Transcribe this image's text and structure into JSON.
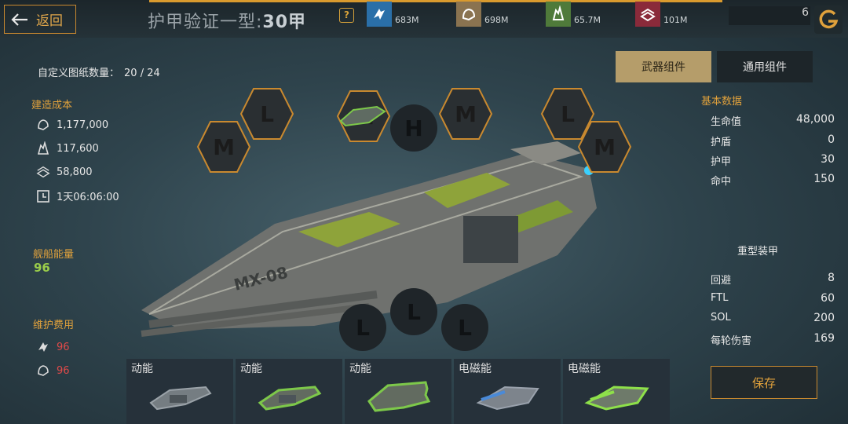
{
  "header": {
    "back_label": "返回",
    "title_text": "护甲验证一型:",
    "title_num": "30甲",
    "help_icon": "?",
    "resources": [
      {
        "icon": "metal-icon",
        "value": "683M",
        "color": "#2a6fa8"
      },
      {
        "icon": "crystal-icon",
        "value": "698M",
        "color": "#8a7350"
      },
      {
        "icon": "deuterium-icon",
        "value": "65.7M",
        "color": "#4f7a3a"
      },
      {
        "icon": "alloy-icon",
        "value": "101M",
        "color": "#8a2a3a"
      }
    ],
    "level": "6"
  },
  "left": {
    "blueprint_label": "自定义图纸数量：",
    "blueprint_count": "20 / 24",
    "build_cost_label": "建造成本",
    "costs": [
      {
        "icon": "ore-icon",
        "value": "1,177,000"
      },
      {
        "icon": "crystal-icon",
        "value": "117,600"
      },
      {
        "icon": "alloy-icon",
        "value": "58,800"
      },
      {
        "icon": "clock-icon",
        "value": "1天06:06:00"
      }
    ],
    "energy_label": "舰船能量",
    "energy_value": "96",
    "upkeep_label": "维护费用",
    "upkeep": [
      {
        "icon": "metal-icon",
        "value": "96"
      },
      {
        "icon": "ore-icon",
        "value": "96"
      }
    ]
  },
  "tabs": {
    "weapon": "武器组件",
    "general": "通用组件"
  },
  "slots": {
    "hex": [
      "L",
      "M",
      "M",
      "M",
      "L",
      "M"
    ],
    "center": "H",
    "bottom": [
      "L",
      "L",
      "L"
    ]
  },
  "ship_hull_text": "MX-08",
  "right": {
    "basic_label": "基本数据",
    "basic": [
      {
        "k": "生命值",
        "v": "48,000"
      },
      {
        "k": "护盾",
        "v": "0"
      },
      {
        "k": "护甲",
        "v": "30"
      },
      {
        "k": "命中",
        "v": "150"
      }
    ],
    "armor_type": "重型装甲",
    "extra": [
      {
        "k": "回避",
        "v": "8"
      },
      {
        "k": "FTL",
        "v": "60"
      },
      {
        "k": "SOL",
        "v": "200"
      },
      {
        "k": "每轮伤害",
        "v": "169"
      }
    ],
    "save_label": "保存"
  },
  "weapons": [
    {
      "label": "动能",
      "color": "#9aa2a8"
    },
    {
      "label": "动能",
      "color": "#7dc84a"
    },
    {
      "label": "动能",
      "color": "#7dc84a"
    },
    {
      "label": "电磁能",
      "color": "#4a8ad8"
    },
    {
      "label": "电磁能",
      "color": "#8ee04a"
    }
  ]
}
